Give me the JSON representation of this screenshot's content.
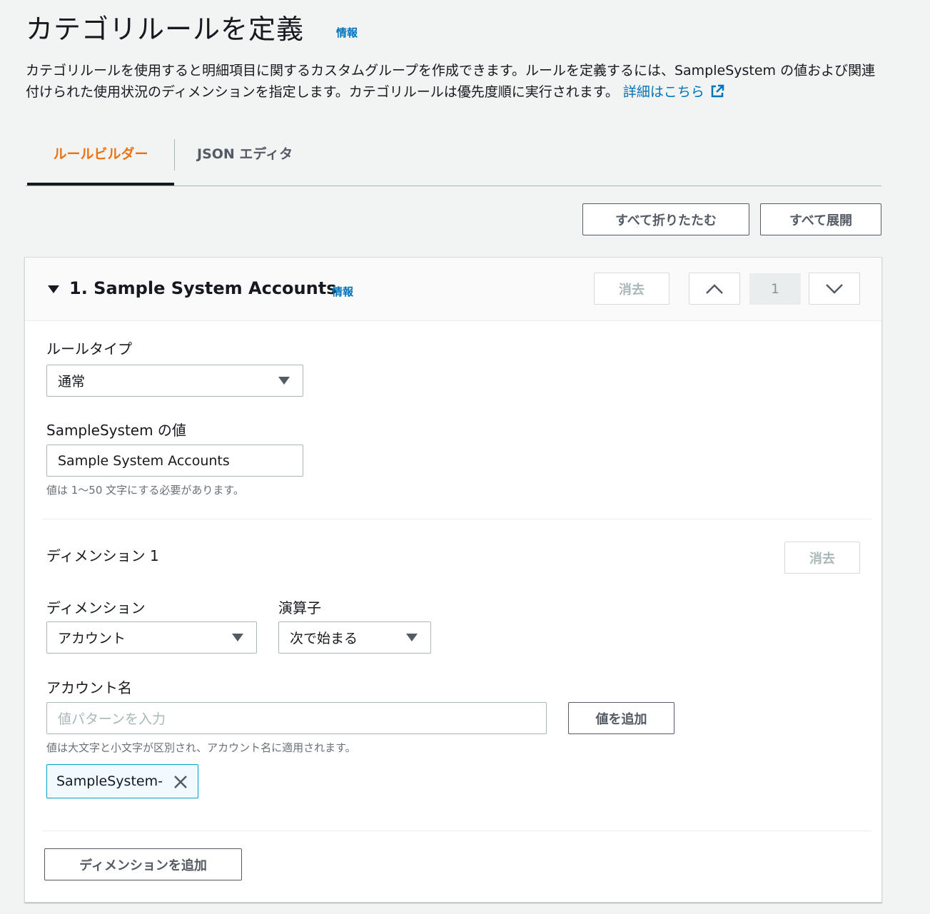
{
  "header": {
    "title": "カテゴリルールを定義",
    "info": "情報",
    "description": "カテゴリルールを使用すると明細項目に関するカスタムグループを作成できます。ルールを定義するには、SampleSystem の値および関連付けられた使用状況のディメンションを指定します。カテゴリルールは優先度順に実行されます。",
    "learn_more": "詳細はこちら"
  },
  "tabs": [
    {
      "label": "ルールビルダー",
      "active": true
    },
    {
      "label": "JSON エディタ",
      "active": false
    }
  ],
  "actions": {
    "collapse_all": "すべて折りたたむ",
    "expand_all": "すべて展開"
  },
  "rule": {
    "title": "1. Sample System Accounts",
    "info": "情報",
    "delete": "消去",
    "order": "1",
    "rule_type_label": "ルールタイプ",
    "rule_type_value": "通常",
    "value_label": "SampleSystem の値",
    "value": "Sample System Accounts",
    "value_hint": "値は 1〜50 文字にする必要があります。",
    "dimension": {
      "title": "ディメンション 1",
      "delete": "消去",
      "dimension_label": "ディメンション",
      "dimension_value": "アカウント",
      "operator_label": "演算子",
      "operator_value": "次で始まる",
      "account_label": "アカウント名",
      "account_placeholder": "値パターンを入力",
      "add_value": "値を追加",
      "account_hint": "値は大文字と小文字が区別され、アカウント名に適用されます。",
      "tokens": [
        "SampleSystem-"
      ]
    },
    "add_dimension": "ディメンションを追加"
  },
  "colors": {
    "accent": "#ec7211",
    "link": "#0073bb",
    "token_border": "#00a1c9"
  }
}
